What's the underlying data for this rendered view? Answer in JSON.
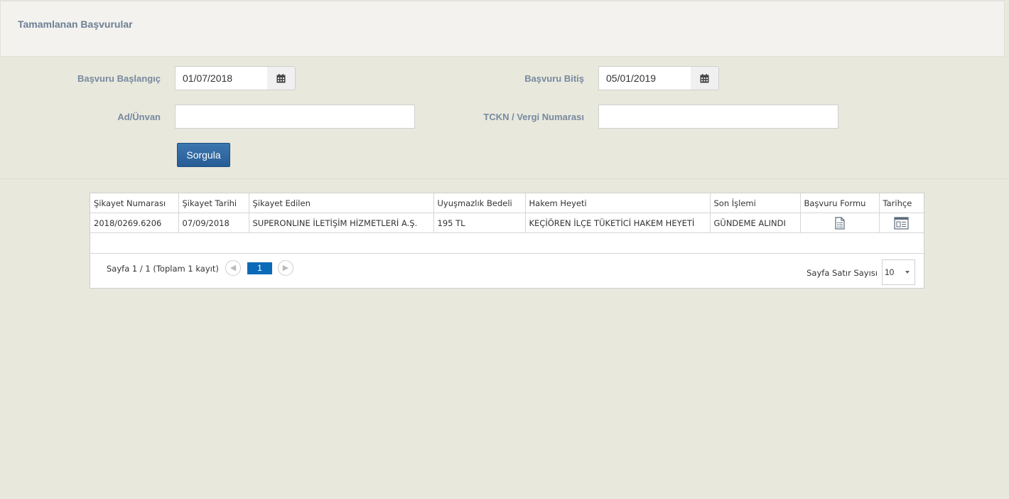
{
  "page_title": "Tamamlanan Başvurular",
  "filters": {
    "start_label": "Başvuru Başlangıç",
    "start_value": "01/07/2018",
    "end_label": "Başvuru Bitiş",
    "end_value": "05/01/2019",
    "name_label": "Ad/Ünvan",
    "name_value": "",
    "tckn_label": "TCKN / Vergi Numarası",
    "tckn_value": "",
    "query_button": "Sorgula"
  },
  "table": {
    "columns": [
      "Şikayet Numarası",
      "Şikayet Tarihi",
      "Şikayet Edilen",
      "Uyuşmazlık Bedeli",
      "Hakem Heyeti",
      "Son İşlemi",
      "Başvuru Formu",
      "Tarihçe"
    ],
    "rows": [
      {
        "complaint_no": "2018/0269.6206",
        "complaint_date": "07/09/2018",
        "respondent": "SUPERONLINE İLETİŞİM HİZMETLERİ A.Ş.",
        "amount": "195 TL",
        "committee": "KEÇİÖREN İLÇE TÜKETİCİ HAKEM HEYETİ",
        "last_action": "GÜNDEME ALINDI",
        "form_icon": "document-icon",
        "history_icon": "history-window-icon"
      }
    ]
  },
  "pager": {
    "info": "Sayfa 1 / 1 (Toplam 1 kayıt)",
    "current_page": "1",
    "rows_label": "Sayfa Satır Sayısı",
    "rows_value": "10"
  }
}
